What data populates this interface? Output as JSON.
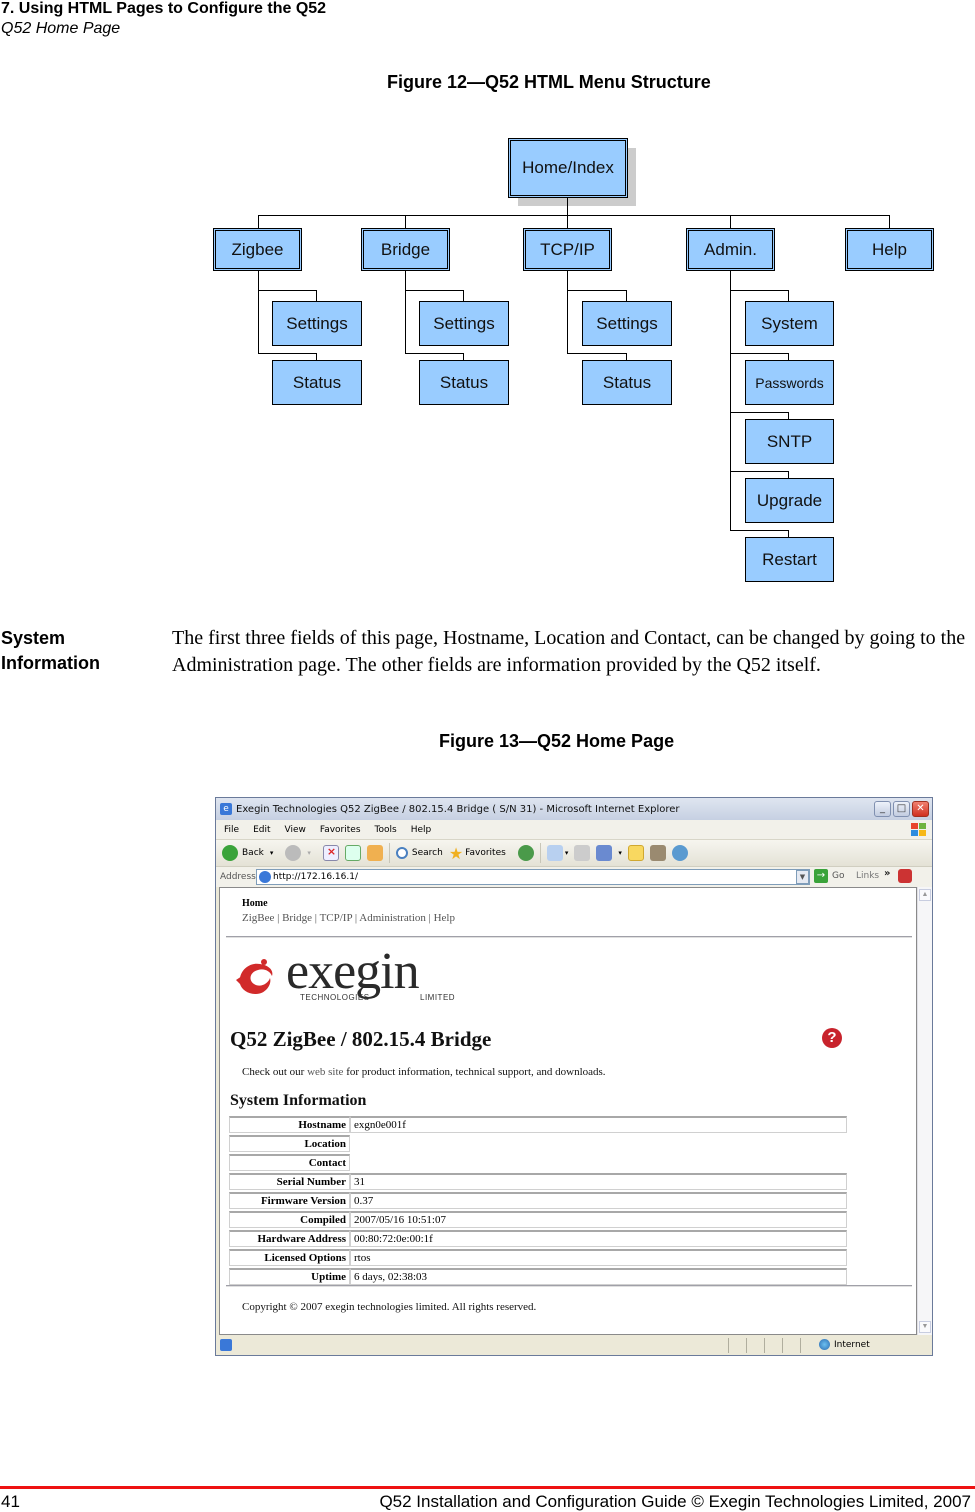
{
  "header": {
    "chapter": "7. Using HTML Pages to Configure the Q52",
    "section": "Q52 Home Page"
  },
  "figure12": {
    "caption": "Figure 12—Q52 HTML Menu Structure",
    "root": "Home/Index",
    "branches": [
      {
        "label": "Zigbee",
        "children": [
          "Settings",
          "Status"
        ]
      },
      {
        "label": "Bridge",
        "children": [
          "Settings",
          "Status"
        ]
      },
      {
        "label": "TCP/IP",
        "children": [
          "Settings",
          "Status"
        ]
      },
      {
        "label": "Admin.",
        "children": [
          "System",
          "Passwords",
          "SNTP",
          "Upgrade",
          "Restart"
        ]
      },
      {
        "label": "Help",
        "children": []
      }
    ],
    "node_color": "#99ccff"
  },
  "body": {
    "side_heading_line1": "System",
    "side_heading_line2": "Information",
    "paragraph": "The first three fields of this page, Hostname, Location and Contact, can be changed by going to the Administration page. The other fields are information provided by the Q52 itself."
  },
  "figure13": {
    "caption": "Figure 13—Q52 Home Page",
    "browser": {
      "title": "Exegin Technologies Q52 ZigBee / 802.15.4 Bridge ( S/N 31) - Microsoft Internet Explorer",
      "window_buttons": {
        "minimize": "_",
        "maximize": "□",
        "close": "✕"
      },
      "menu": [
        "File",
        "Edit",
        "View",
        "Favorites",
        "Tools",
        "Help"
      ],
      "toolbar": {
        "back": "Back",
        "search": "Search",
        "favorites": "Favorites"
      },
      "address_label": "Address",
      "address_value": "http://172.16.16.1/",
      "go_label": "Go",
      "links_label": "Links",
      "links_more": "»",
      "status_zone": "Internet"
    },
    "page": {
      "home_heading": "Home",
      "nav": [
        "ZigBee",
        "Bridge",
        "TCP/IP",
        "Administration",
        "Help"
      ],
      "nav_separator": " | ",
      "logo_word": "exegin",
      "logo_sub_left": "TECHNOLOGIES",
      "logo_sub_right": "LIMITED",
      "title": "Q52 ZigBee / 802.15.4 Bridge",
      "help_icon": "?",
      "checkout_prefix": "Check out our ",
      "checkout_link": "web site",
      "checkout_suffix": " for product information, technical support, and downloads.",
      "sysinfo_heading": "System Information",
      "sysinfo": [
        {
          "label": "Hostname",
          "value": "exgn0e001f"
        },
        {
          "label": "Location",
          "value": ""
        },
        {
          "label": "Contact",
          "value": ""
        },
        {
          "label": "Serial Number",
          "value": "31"
        },
        {
          "label": "Firmware Version",
          "value": "0.37"
        },
        {
          "label": "Compiled",
          "value": "2007/05/16 10:51:07"
        },
        {
          "label": "Hardware Address",
          "value": "00:80:72:0e:00:1f"
        },
        {
          "label": "Licensed Options",
          "value": "rtos"
        },
        {
          "label": "Uptime",
          "value": "6 days, 02:38:03"
        }
      ],
      "copyright": "Copyright © 2007 exegin technologies limited. All rights reserved."
    }
  },
  "footer": {
    "page_number": "41",
    "text": "Q52 Installation and Configuration Guide  © Exegin Technologies Limited, 2007",
    "rule_color": "#ee1111"
  }
}
